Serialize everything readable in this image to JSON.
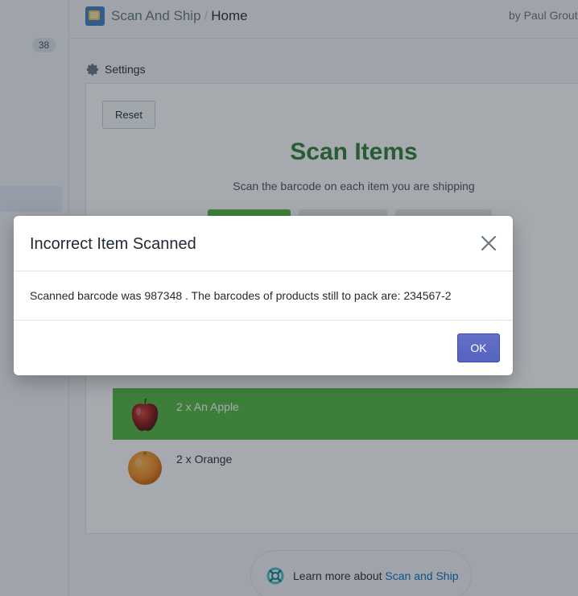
{
  "nav": {
    "badge_count": "38"
  },
  "header": {
    "app_name": "Scan And Ship",
    "separator": "/",
    "page": "Home",
    "byline": "by Paul Grout"
  },
  "settings": {
    "label": "Settings",
    "icon": "gear-icon"
  },
  "main": {
    "reset_label": "Reset",
    "title": "Scan Items",
    "subtitle": "Scan the barcode on each item you are shipping",
    "title_color": "#2e7d32",
    "items": [
      {
        "label": "2 x An Apple",
        "status": "scanned",
        "icon": "apple-image"
      },
      {
        "label": "2 x Orange",
        "status": "pending",
        "icon": "orange-image"
      }
    ]
  },
  "footer": {
    "text": "Learn more about ",
    "link": "Scan and Ship"
  },
  "modal": {
    "title": "Incorrect Item Scanned",
    "message": "Scanned barcode was 987348 . The barcodes of products still to pack are: 234567-2",
    "ok_label": "OK",
    "accent": "#5c6ac4"
  }
}
